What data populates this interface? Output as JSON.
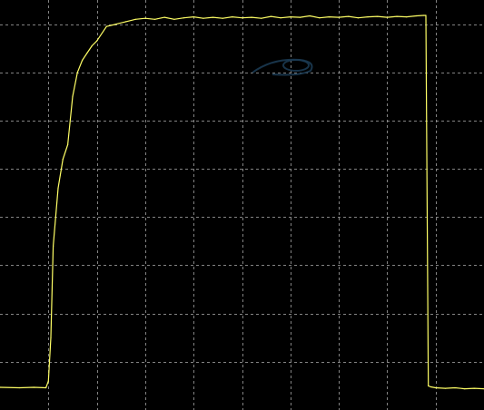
{
  "screen": {
    "background": "#000000",
    "grid_color": "#9a9a9a",
    "trace_color": "#ffff66",
    "watermark_color": "#1b3a52"
  },
  "chart_data": {
    "type": "line",
    "title": "",
    "xlabel": "",
    "ylabel": "",
    "xlim": [
      0,
      10
    ],
    "ylim": [
      0,
      8.5
    ],
    "grid": true,
    "grid_divisions": {
      "x": 10,
      "y": 8
    },
    "series": [
      {
        "color": "#ffff66",
        "x": [
          0.0,
          0.4,
          0.7,
          0.95,
          1.0,
          1.05,
          1.1,
          1.2,
          1.3,
          1.4,
          1.5,
          1.6,
          1.7,
          1.8,
          1.9,
          2.0,
          2.2,
          2.4,
          2.6,
          2.8,
          3.0,
          3.2,
          3.4,
          3.6,
          3.8,
          4.0,
          4.2,
          4.4,
          4.6,
          4.8,
          5.0,
          5.2,
          5.4,
          5.6,
          5.8,
          6.0,
          6.2,
          6.4,
          6.6,
          6.8,
          7.0,
          7.2,
          7.4,
          7.6,
          7.8,
          8.0,
          8.2,
          8.4,
          8.6,
          8.75,
          8.8,
          8.85,
          8.9,
          9.0,
          9.2,
          9.4,
          9.6,
          9.8,
          10.0
        ],
        "y": [
          0.47,
          0.46,
          0.47,
          0.46,
          0.6,
          1.5,
          3.4,
          4.6,
          5.2,
          5.5,
          6.5,
          7.0,
          7.25,
          7.4,
          7.55,
          7.65,
          7.95,
          8.0,
          8.05,
          8.1,
          8.12,
          8.1,
          8.14,
          8.1,
          8.13,
          8.15,
          8.12,
          8.14,
          8.12,
          8.15,
          8.13,
          8.14,
          8.12,
          8.16,
          8.13,
          8.15,
          8.14,
          8.17,
          8.13,
          8.15,
          8.14,
          8.16,
          8.13,
          8.15,
          8.16,
          8.14,
          8.16,
          8.15,
          8.17,
          8.18,
          8.18,
          0.5,
          0.48,
          0.46,
          0.45,
          0.46,
          0.44,
          0.45,
          0.44
        ]
      }
    ]
  }
}
